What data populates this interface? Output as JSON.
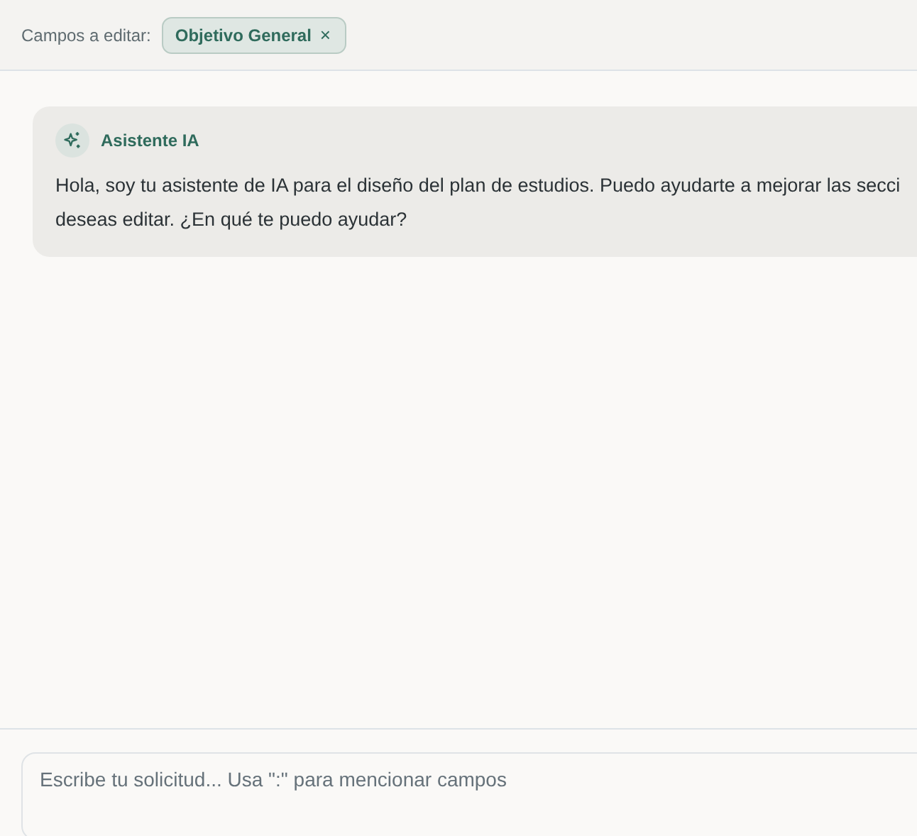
{
  "header": {
    "label": "Campos a editar:",
    "chips": [
      {
        "label": "Objetivo General",
        "remove": "×"
      }
    ]
  },
  "messages": [
    {
      "kind": "assistant",
      "sender": "Asistente IA",
      "lines": [
        "Hola, soy tu asistente de IA para el diseño del plan de estudios. Puedo ayudarte a mejorar las secci",
        "deseas editar. ¿En qué te puedo ayudar?"
      ]
    }
  ],
  "composer": {
    "placeholder": "Escribe tu solicitud... Usa \":\" para mencionar campos"
  }
}
